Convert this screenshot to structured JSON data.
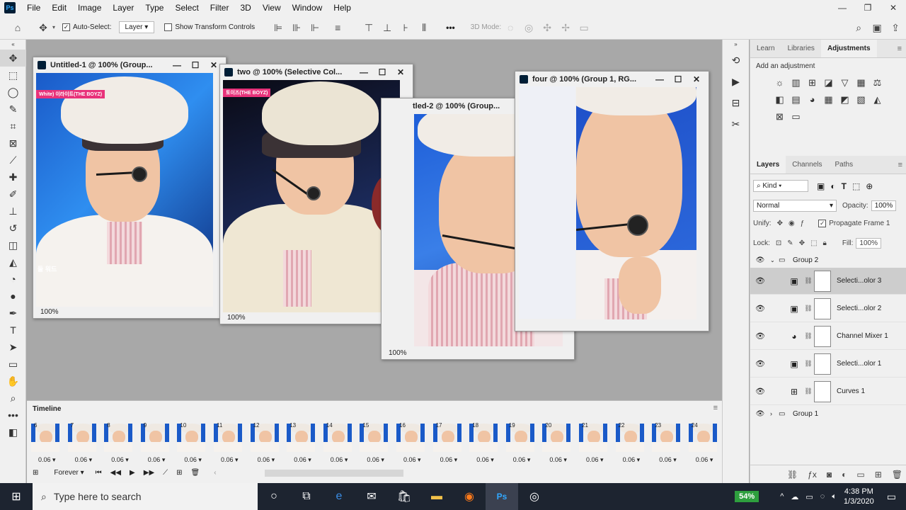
{
  "menubar": {
    "logo": "Ps",
    "items": [
      "File",
      "Edit",
      "Image",
      "Layer",
      "Type",
      "Select",
      "Filter",
      "3D",
      "View",
      "Window",
      "Help"
    ],
    "win_controls": [
      "—",
      "❐",
      "✕"
    ]
  },
  "options": {
    "auto_select_label": "Auto-Select:",
    "auto_select_value": "Layer",
    "transform_label": "Show Transform Controls",
    "mode_3d": "3D Mode:",
    "more": "•••"
  },
  "docs": [
    {
      "title": "Untitled-1 @ 100% (Group...",
      "zoom": "100%",
      "tag": "White) 이라이트(THE BOYZ)",
      "side_text": "둘 워드"
    },
    {
      "title": "two @ 100% (Selective Col...",
      "zoom": "100%",
      "tag": "토이즈(THE BOYZ)"
    },
    {
      "title": "tled-2 @ 100% (Group...",
      "zoom": "100%"
    },
    {
      "title": "four @ 100% (Group 1, RG...",
      "zoom": ""
    }
  ],
  "adjustments": {
    "tabs": [
      "Learn",
      "Libraries",
      "Adjustments"
    ],
    "active_tab": "Adjustments",
    "hint": "Add an adjustment"
  },
  "layers_panel": {
    "tabs": [
      "Layers",
      "Channels",
      "Paths"
    ],
    "kind": "Kind",
    "blend": "Normal",
    "opacity_label": "Opacity:",
    "opacity": "100%",
    "unify_label": "Unify:",
    "propagate": "Propagate Frame 1",
    "lock_label": "Lock:",
    "fill_label": "Fill:",
    "fill": "100%",
    "group_open": "Group 2",
    "layers": [
      {
        "name": "Selecti...olor 3",
        "icon": "▣",
        "selected": true
      },
      {
        "name": "Selecti...olor 2",
        "icon": "▣",
        "selected": false
      },
      {
        "name": "Channel Mixer 1",
        "icon": "◕",
        "selected": false
      },
      {
        "name": "Selecti...olor 1",
        "icon": "▣",
        "selected": false
      },
      {
        "name": "Curves 1",
        "icon": "⊞",
        "selected": false
      }
    ],
    "group_closed": "Group 1"
  },
  "timeline": {
    "title": "Timeline",
    "loop": "Forever",
    "frames": [
      {
        "num": "6",
        "delay": "0.06"
      },
      {
        "num": "7",
        "delay": "0.06"
      },
      {
        "num": "8",
        "delay": "0.06"
      },
      {
        "num": "9",
        "delay": "0.06"
      },
      {
        "num": "10",
        "delay": "0.06"
      },
      {
        "num": "11",
        "delay": "0.06"
      },
      {
        "num": "12",
        "delay": "0.06"
      },
      {
        "num": "13",
        "delay": "0.06"
      },
      {
        "num": "14",
        "delay": "0.06"
      },
      {
        "num": "15",
        "delay": "0.06"
      },
      {
        "num": "16",
        "delay": "0.06"
      },
      {
        "num": "17",
        "delay": "0.06"
      },
      {
        "num": "18",
        "delay": "0.06"
      },
      {
        "num": "19",
        "delay": "0.06"
      },
      {
        "num": "20",
        "delay": "0.06"
      },
      {
        "num": "21",
        "delay": "0.06"
      },
      {
        "num": "22",
        "delay": "0.06"
      },
      {
        "num": "23",
        "delay": "0.06"
      },
      {
        "num": "24",
        "delay": "0.06"
      }
    ]
  },
  "taskbar": {
    "search_placeholder": "Type here to search",
    "battery": "54%",
    "time": "4:38 PM",
    "date": "1/3/2020"
  },
  "colors": {
    "accent": "#31a8ff",
    "ps_dark": "#001e36",
    "taskbar": "#1d2430",
    "highlight_tag": "#e8327a"
  }
}
